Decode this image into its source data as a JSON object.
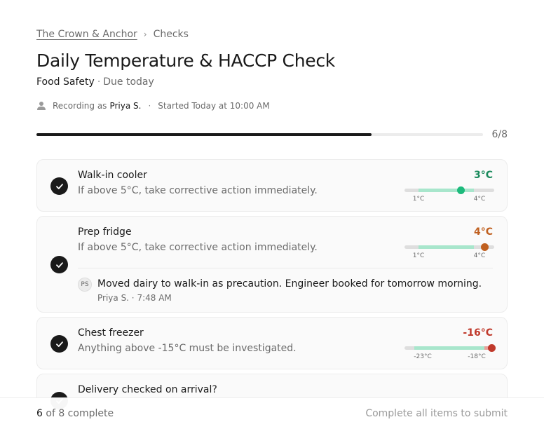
{
  "breadcrumb": {
    "venue": "The Crown & Anchor",
    "section": "Checks"
  },
  "header": {
    "title": "Daily Temperature & HACCP Check",
    "category": "Food Safety",
    "due": "Due today",
    "recording_prefix": "Recording as",
    "user": "Priya S.",
    "started": "Started Today at 10:00 AM"
  },
  "progress": {
    "completed": 6,
    "total": 8,
    "text": "6/8"
  },
  "items": [
    {
      "title": "Walk-in cooler",
      "description": "If above 5°C, take corrective action immediately.",
      "reading": "3°C",
      "status_color": "#1a8a5c",
      "range_min_label": "1°C",
      "range_max_label": "4°C",
      "completed": true
    },
    {
      "title": "Prep fridge",
      "description": "If above 5°C, take corrective action immediately.",
      "reading": "4°C",
      "status_color": "#c06020",
      "range_min_label": "1°C",
      "range_max_label": "4°C",
      "completed": true,
      "comment": {
        "initials": "PS",
        "text": "Moved dairy to walk-in as precaution. Engineer booked for tomorrow morning.",
        "meta": "Priya S. · 7:48 AM"
      }
    },
    {
      "title": "Chest freezer",
      "description": "Anything above -15°C must be investigated.",
      "reading": "-16°C",
      "status_color": "#c0392b",
      "range_min_label": "-23°C",
      "range_max_label": "-18°C",
      "completed": true
    },
    {
      "title": "Delivery checked on arrival?",
      "completed": true
    }
  ],
  "footer": {
    "complete_count": "6",
    "complete_suffix": "of 8 complete",
    "submit_label": "Complete all items to submit"
  },
  "colors": {
    "ok": "#1dba7c",
    "warn": "#c06020",
    "alert": "#c0392b",
    "accent": "#1a1a1a"
  }
}
